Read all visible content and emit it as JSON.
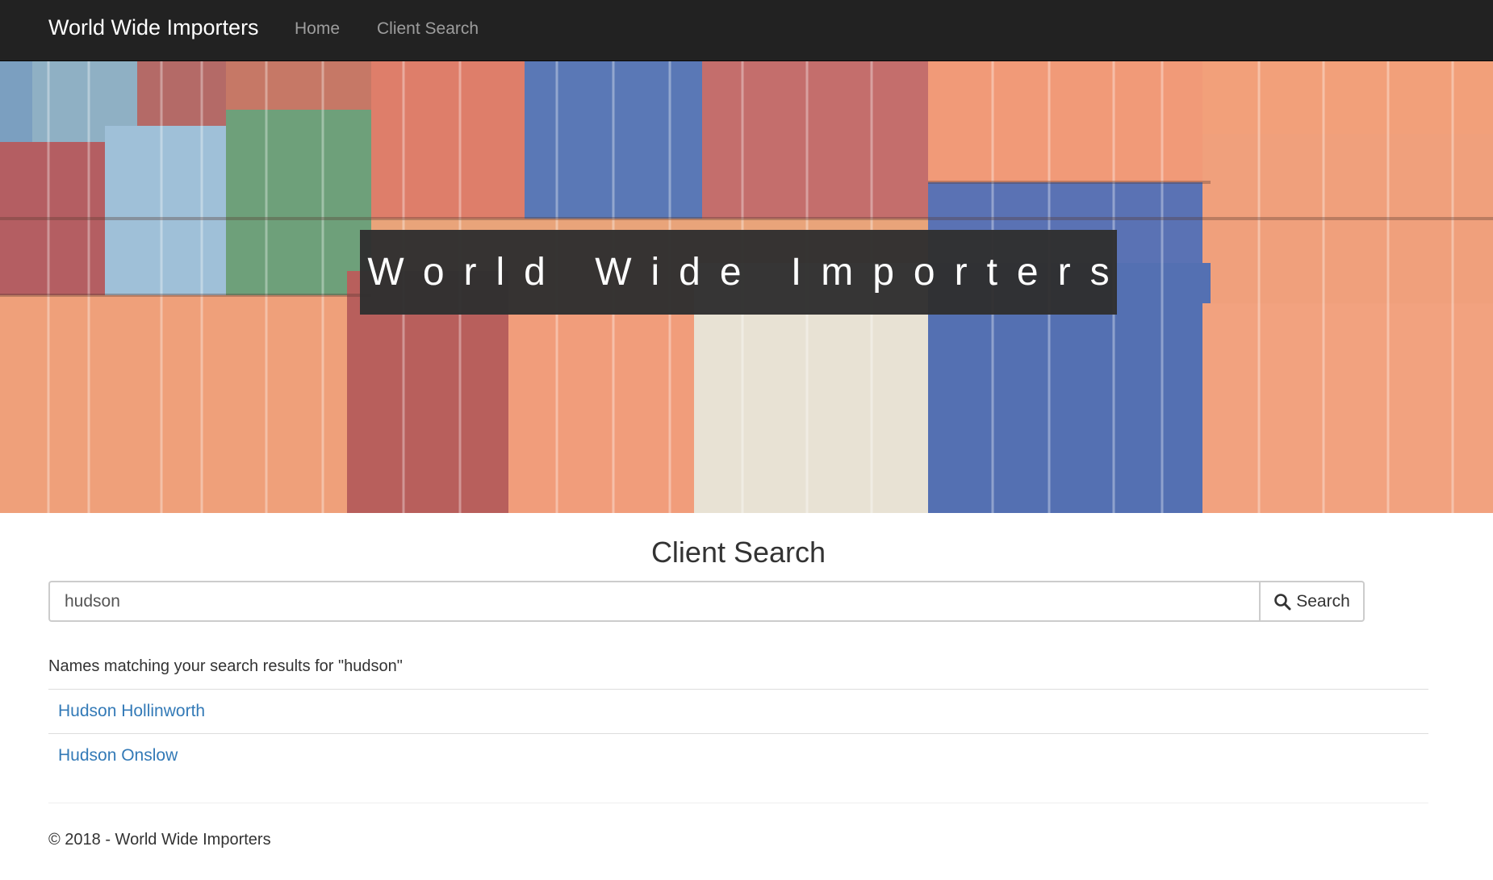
{
  "navbar": {
    "brand": "World Wide Importers",
    "links": [
      {
        "label": "Home"
      },
      {
        "label": "Client Search"
      }
    ]
  },
  "hero": {
    "title": "World Wide Importers"
  },
  "search": {
    "heading": "Client Search",
    "query": "hudson",
    "button_label": "Search",
    "button_icon": "search-icon"
  },
  "results": {
    "caption": "Names matching your search results for \"hudson\"",
    "items": [
      {
        "name": "Hudson Hollinworth"
      },
      {
        "name": "Hudson Onslow"
      }
    ]
  },
  "footer": {
    "text": "© 2018 - World Wide Importers"
  },
  "colors": {
    "navbar_bg": "#222222",
    "link": "#337ab7",
    "hero_overlay": "#303030"
  }
}
